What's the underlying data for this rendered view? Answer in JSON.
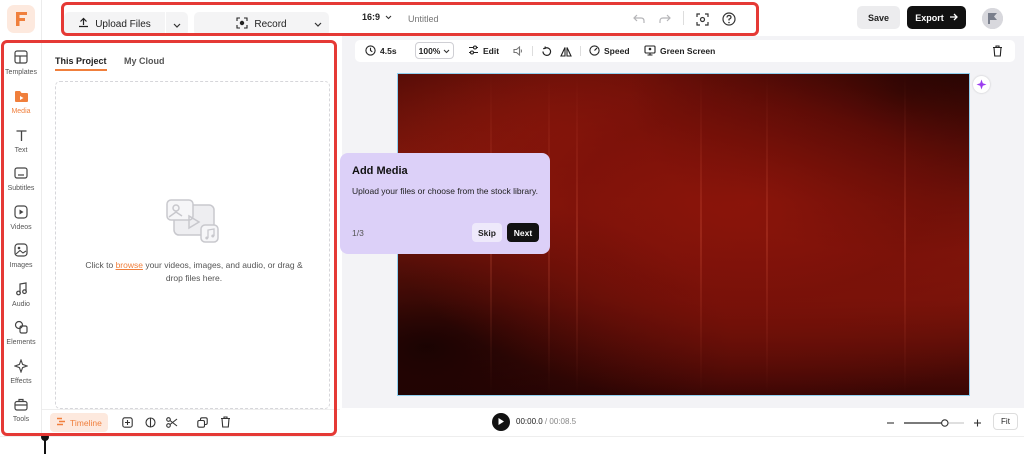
{
  "app": {
    "brand_color": "#f07f3c",
    "logo": "flexclip-logo-icon"
  },
  "rail": {
    "items": [
      {
        "label": "Templates",
        "icon": "templates-icon"
      },
      {
        "label": "Media",
        "icon": "media-folder-icon",
        "active": true
      },
      {
        "label": "Text",
        "icon": "text-icon"
      },
      {
        "label": "Subtitles",
        "icon": "subtitles-icon"
      },
      {
        "label": "Videos",
        "icon": "videos-icon"
      },
      {
        "label": "Images",
        "icon": "images-icon"
      },
      {
        "label": "Audio",
        "icon": "audio-icon"
      },
      {
        "label": "Elements",
        "icon": "elements-icon"
      },
      {
        "label": "Effects",
        "icon": "effects-icon"
      },
      {
        "label": "Tools",
        "icon": "tools-icon"
      }
    ]
  },
  "topbar": {
    "upload_label": "Upload Files",
    "record_label": "Record",
    "aspect_ratio": "16:9",
    "project_title_placeholder": "Untitled",
    "save_label": "Save",
    "export_label": "Export"
  },
  "media_panel": {
    "tabs": [
      {
        "label": "This Project",
        "active": true
      },
      {
        "label": "My Cloud",
        "active": false
      }
    ],
    "dropzone_before": "Click to ",
    "dropzone_link": "browse",
    "dropzone_after": " your videos, images, and audio, or drag & drop files here.",
    "timeline_label": "Timeline"
  },
  "toolbar": {
    "duration": "4.5s",
    "zoom": "100%",
    "edit_label": "Edit",
    "speed_label": "Speed",
    "green_screen_label": "Green Screen"
  },
  "tooltip": {
    "title": "Add Media",
    "body": "Upload your files or choose from the stock library.",
    "step": "1/3",
    "skip_label": "Skip",
    "next_label": "Next"
  },
  "playback": {
    "current": "00:00.0",
    "separator": " / ",
    "total": "00:08.5",
    "fit_label": "Fit",
    "zoom_level": 0.68
  },
  "canvas": {
    "background": "dark red grunge texture"
  }
}
